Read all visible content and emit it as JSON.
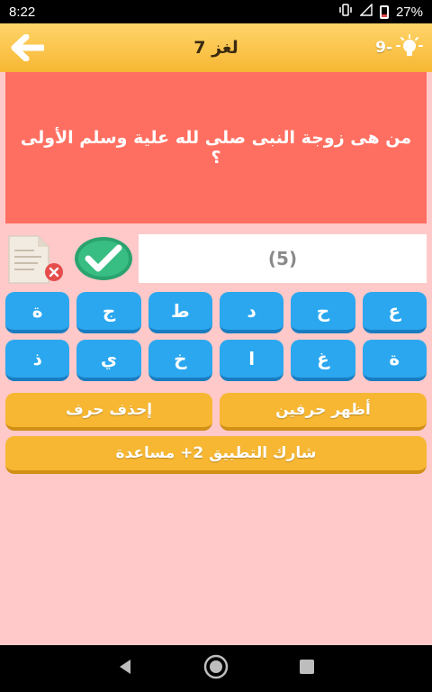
{
  "status": {
    "time": "8:22",
    "battery": "27%"
  },
  "header": {
    "title": "لغز 7",
    "hints": "9-"
  },
  "question": "من هى زوجة النبى صلى لله علية وسلم  الأولى ؟",
  "answer": {
    "placeholder": "(5)"
  },
  "keys": {
    "row1": [
      "ع",
      "ح",
      "د",
      "ط",
      "ج",
      "ة"
    ],
    "row2": [
      "ة",
      "غ",
      "ا",
      "خ",
      "ي",
      "ذ"
    ]
  },
  "actions": {
    "show_two": "أظهر حرفين",
    "delete_letter": "إحذف حرف",
    "share": "شارك التطبيق 2+ مساعدة"
  },
  "colors": {
    "header": "#f7b733",
    "question_panel": "#ff6f61",
    "key": "#2aa7ef",
    "background": "#ffc9c9"
  }
}
